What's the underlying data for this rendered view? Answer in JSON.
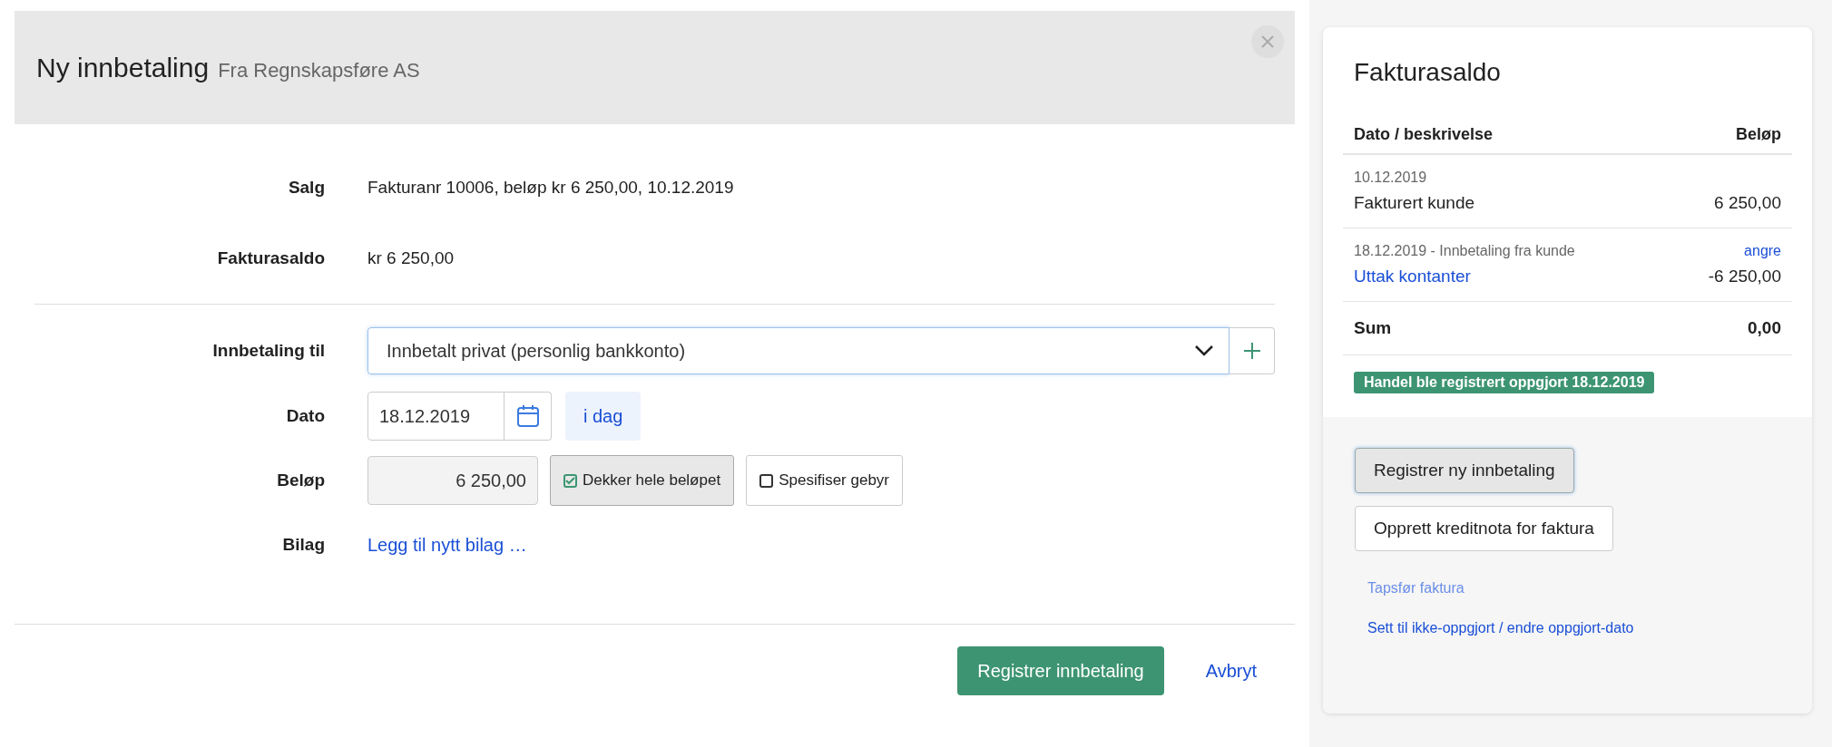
{
  "dialog": {
    "title": "Ny innbetaling",
    "subtitle": "Fra Regnskapsføre AS"
  },
  "summary": [
    {
      "label": "Salg",
      "value": "Fakturanr 10006, beløp kr 6 250,00, 10.12.2019"
    },
    {
      "label": "Fakturasaldo",
      "value": "kr 6 250,00"
    }
  ],
  "form": {
    "payment_to": {
      "label": "Innbetaling til",
      "value": "Innbetalt privat (personlig bankkonto)"
    },
    "date": {
      "label": "Dato",
      "value": "18.12.2019",
      "today_button": "i dag"
    },
    "amount": {
      "label": "Beløp",
      "value": "6 250,00",
      "disabled": true,
      "options": [
        {
          "label": "Dekker hele beløpet",
          "checked": true
        },
        {
          "label": "Spesifiser gebyr",
          "checked": false
        }
      ]
    },
    "attachment": {
      "label": "Bilag",
      "link": "Legg til nytt bilag …"
    }
  },
  "footer": {
    "primary": "Registrer innbetaling",
    "cancel": "Avbryt"
  },
  "balance_card": {
    "title": "Fakturasaldo",
    "columns": [
      "Dato / beskrivelse",
      "Beløp"
    ],
    "entries": [
      {
        "kind": "plain",
        "meta": "10.12.2019",
        "description": "Fakturert kunde",
        "amount": "6 250,00"
      },
      {
        "kind": "link",
        "meta": "18.12.2019 - Innbetaling fra kunde",
        "action": "angre",
        "description": "Uttak kontanter",
        "amount": "-6 250,00"
      }
    ],
    "sum": {
      "label": "Sum",
      "value": "0,00"
    },
    "status_badge": "Handel ble registrert oppgjort 18.12.2019",
    "buttons": [
      {
        "label": "Registrer ny innbetaling",
        "focused": true
      },
      {
        "label": "Opprett kreditnota for faktura",
        "focused": false
      }
    ],
    "links": [
      {
        "label": "Tapsfør faktura",
        "disabled": true
      },
      {
        "label": "Sett til ikke-oppgjort / endre oppgjort-dato",
        "disabled": false
      }
    ]
  }
}
